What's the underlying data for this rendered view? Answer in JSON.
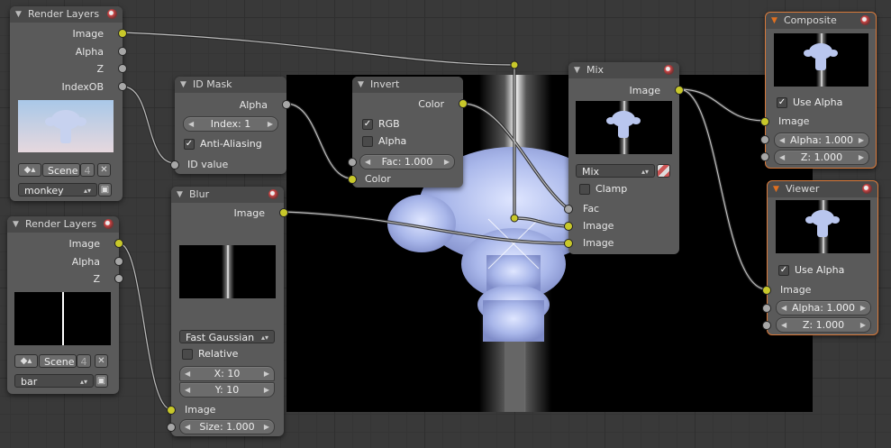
{
  "colors": {
    "grid_bg": "#393939",
    "node_bg": "#5a5a5a",
    "header_bg": "#4a4a4a",
    "socket_image": "#c8c82a",
    "socket_value": "#a7a7a7",
    "selected_border": "#d8793a"
  },
  "render_layers_1": {
    "title": "Render Layers",
    "out_image": "Image",
    "out_alpha": "Alpha",
    "out_z": "Z",
    "out_indexob": "IndexOB",
    "scene_label": "Scene",
    "scene_users": "4",
    "layer_value": "monkey"
  },
  "render_layers_2": {
    "title": "Render Layers",
    "out_image": "Image",
    "out_alpha": "Alpha",
    "out_z": "Z",
    "scene_label": "Scene",
    "scene_users": "4",
    "layer_value": "bar"
  },
  "id_mask": {
    "title": "ID Mask",
    "out_alpha": "Alpha",
    "index_field": "Index: 1",
    "anti_aliasing_label": "Anti-Aliasing",
    "anti_aliasing_checked": true,
    "in_id_value": "ID value"
  },
  "blur": {
    "title": "Blur",
    "out_image": "Image",
    "filter_type": "Fast Gaussian",
    "relative_label": "Relative",
    "relative_checked": false,
    "x_field": "X: 10",
    "y_field": "Y: 10",
    "in_image": "Image",
    "size_field": "Size: 1.000"
  },
  "invert": {
    "title": "Invert",
    "out_color": "Color",
    "rgb_label": "RGB",
    "rgb_checked": true,
    "alpha_label": "Alpha",
    "alpha_checked": false,
    "fac_field": "Fac: 1.000",
    "in_color": "Color"
  },
  "mix": {
    "title": "Mix",
    "out_image": "Image",
    "blend_mode": "Mix",
    "clamp_label": "Clamp",
    "clamp_checked": false,
    "in_fac": "Fac",
    "in_image1": "Image",
    "in_image2": "Image"
  },
  "composite": {
    "title": "Composite",
    "use_alpha_label": "Use Alpha",
    "use_alpha_checked": true,
    "in_image": "Image",
    "alpha_field": "Alpha: 1.000",
    "z_field": "Z: 1.000"
  },
  "viewer": {
    "title": "Viewer",
    "use_alpha_label": "Use Alpha",
    "use_alpha_checked": true,
    "in_image": "Image",
    "alpha_field": "Alpha: 1.000",
    "z_field": "Z: 1.000"
  }
}
